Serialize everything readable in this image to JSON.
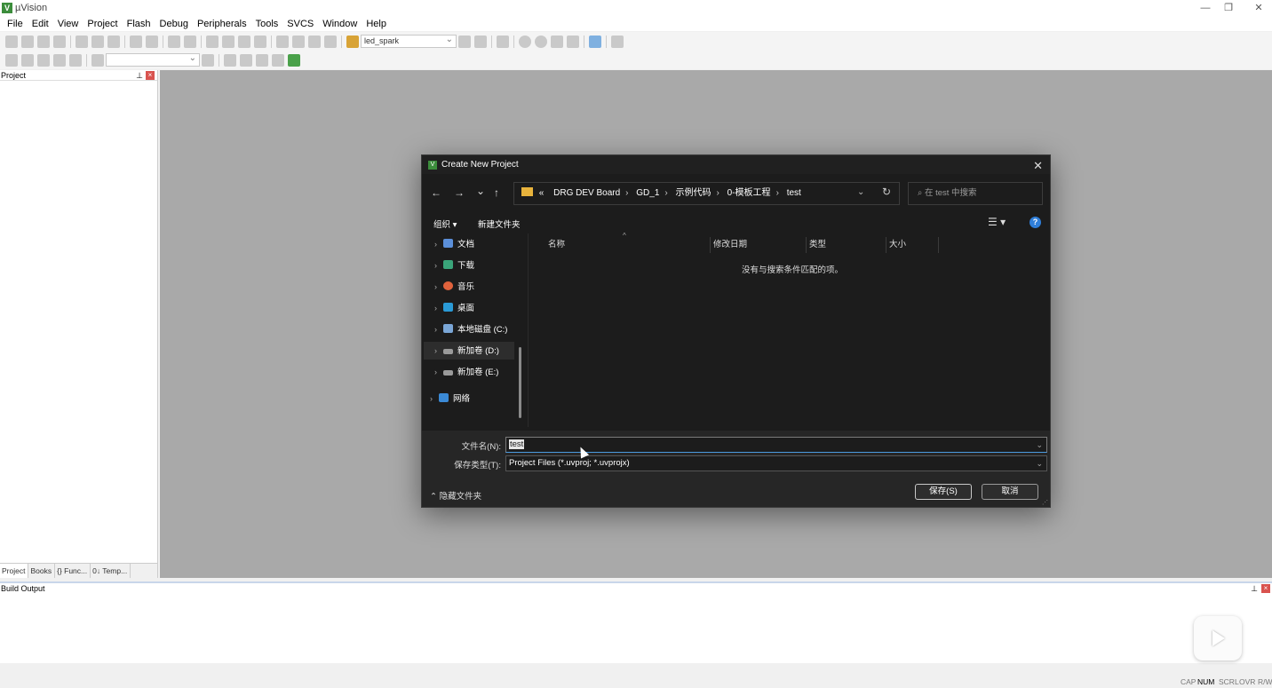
{
  "window": {
    "title": "µVision",
    "minimize": "—",
    "restore": "❐",
    "close": "✕"
  },
  "menu": [
    "File",
    "Edit",
    "View",
    "Project",
    "Flash",
    "Debug",
    "Peripherals",
    "Tools",
    "SVCS",
    "Window",
    "Help"
  ],
  "toolbar": {
    "target_combo": "led_spark"
  },
  "project_pane": {
    "title": "Project",
    "tabs": [
      "Project",
      "Books",
      "{} Func...",
      "0↓ Temp..."
    ]
  },
  "build_output": {
    "title": "Build Output"
  },
  "statusbar": [
    "CAP",
    "NUM",
    "SCRL",
    "OVR",
    "R/W"
  ],
  "dialog": {
    "title": "Create New Project",
    "nav": {
      "back": "←",
      "forward": "→",
      "recent": "⌄",
      "up": "↑",
      "refresh": "↻"
    },
    "breadcrumb": [
      "«",
      "DRG DEV Board",
      "GD_1",
      "示例代码",
      "0-模板工程",
      "test"
    ],
    "search_placeholder": "在 test 中搜索",
    "commands": {
      "organize": "组织 ▾",
      "new_folder": "新建文件夹"
    },
    "tree": [
      {
        "label": "文档",
        "color": "#5b8fd9"
      },
      {
        "label": "下载",
        "color": "#3aa57a"
      },
      {
        "label": "音乐",
        "color": "#e0623c"
      },
      {
        "label": "桌面",
        "color": "#2a9ad6"
      },
      {
        "label": "本地磁盘 (C:)",
        "color": "#7aa6d6"
      },
      {
        "label": "新加卷 (D:)",
        "color": "#9a9a9a"
      },
      {
        "label": "新加卷 (E:)",
        "color": "#9a9a9a"
      },
      {
        "label": "网络",
        "color": "#3b8ad6"
      }
    ],
    "columns": [
      "名称",
      "修改日期",
      "类型",
      "大小"
    ],
    "empty_message": "没有与搜索条件匹配的项。",
    "filename_label": "文件名(N):",
    "filename_value": "test",
    "filetype_label": "保存类型(T):",
    "filetype_value": "Project Files (*.uvproj; *.uvprojx)",
    "hide_folders": "隐藏文件夹",
    "save": "保存(S)",
    "cancel": "取消"
  }
}
